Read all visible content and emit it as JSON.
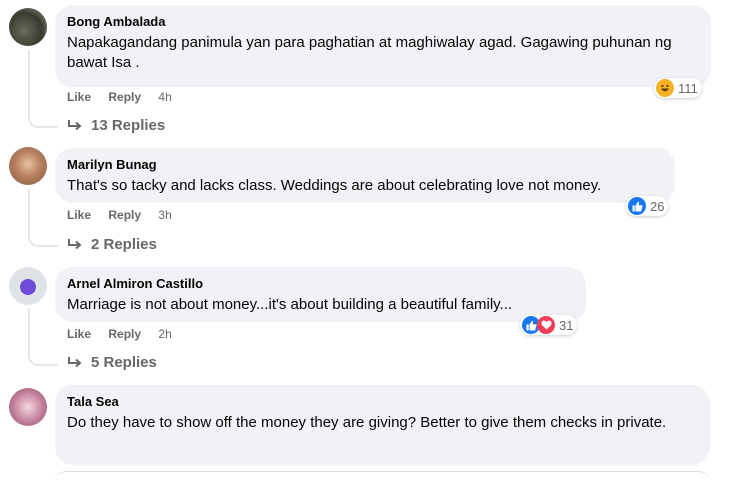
{
  "comments": [
    {
      "author": "Bong Ambalada",
      "text": "Napakagandang panimula yan para paghatian at maghiwalay agad. Gagawing puhunan ng bawat Isa .",
      "like": "Like",
      "reply": "Reply",
      "time": "4h",
      "reaction_count": "111",
      "reactions": [
        "haha-icon"
      ],
      "replies": "13 Replies"
    },
    {
      "author": "Marilyn Bunag",
      "text": "That's so tacky and lacks class. Weddings are about celebrating love not money.",
      "like": "Like",
      "reply": "Reply",
      "time": "3h",
      "reaction_count": "26",
      "reactions": [
        "like-icon"
      ],
      "replies": "2 Replies"
    },
    {
      "author": "Arnel Almiron Castillo",
      "text": "Marriage is not about money...it's about building a beautiful family...",
      "like": "Like",
      "reply": "Reply",
      "time": "2h",
      "reaction_count": "31",
      "reactions": [
        "like-icon",
        "love-icon"
      ],
      "replies": "5 Replies"
    },
    {
      "author": "Tala Sea",
      "text": "Do they have to show off the money they are giving? Better to give them checks in private."
    }
  ],
  "colors": {
    "bubble": "#f0f2f5",
    "secondary_text": "#65676b",
    "like_blue": "#1877f2",
    "love_red": "#f33e58",
    "haha_yellow": "#f7b125"
  }
}
